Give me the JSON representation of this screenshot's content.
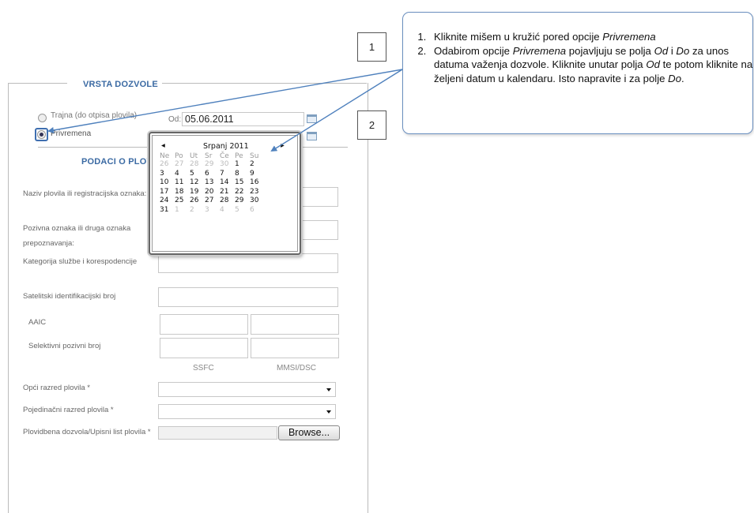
{
  "form": {
    "permit_section_title": "VRSTA DOZVOLE",
    "permit_options": [
      {
        "label": "Trajna (do otpisa plovila)",
        "selected": false
      },
      {
        "label": "Privremena",
        "selected": true
      }
    ],
    "from_label": "Od:",
    "from_value": "05.06.2011",
    "vessel_section_title": "PODACI O PLOV",
    "fields": [
      {
        "label": "Naziv plovila ili registracijska oznaka: *",
        "value": ""
      },
      {
        "label": "Pozivna oznaka ili druga oznaka prepoznavanja:",
        "value": ""
      },
      {
        "label": "Kategorija službe i korespodencije",
        "value": ""
      },
      {
        "label": "Satelitski identifikacijski broj",
        "value": ""
      },
      {
        "label": "AAIC",
        "value": ""
      },
      {
        "label": "Selektivni pozivni broj",
        "value": ""
      }
    ],
    "column_labels": [
      "SSFC",
      "MMSI/DSC"
    ],
    "selects": [
      {
        "label": "Opći razred plovila *",
        "value": ""
      },
      {
        "label": "Pojedinačni razred plovila *",
        "value": ""
      }
    ],
    "upload": {
      "label": "Plovidbena dozvola/Upisni list plovila *",
      "button": "Browse..."
    }
  },
  "datepicker": {
    "prev": "◂",
    "next": "▸",
    "month": "Srpanj 2011",
    "weekdays": [
      "Ne",
      "Po",
      "Ut",
      "Sr",
      "Če",
      "Pe",
      "Su"
    ],
    "weeks": [
      [
        {
          "d": "26",
          "m": true
        },
        {
          "d": "27",
          "m": true
        },
        {
          "d": "28",
          "m": true
        },
        {
          "d": "29",
          "m": true
        },
        {
          "d": "30",
          "m": true
        },
        {
          "d": "1",
          "m": false
        },
        {
          "d": "2",
          "m": false
        }
      ],
      [
        {
          "d": "3",
          "m": false
        },
        {
          "d": "4",
          "m": false
        },
        {
          "d": "5",
          "m": false
        },
        {
          "d": "6",
          "m": false
        },
        {
          "d": "7",
          "m": false
        },
        {
          "d": "8",
          "m": false
        },
        {
          "d": "9",
          "m": false
        }
      ],
      [
        {
          "d": "10",
          "m": false
        },
        {
          "d": "11",
          "m": false
        },
        {
          "d": "12",
          "m": false
        },
        {
          "d": "13",
          "m": false
        },
        {
          "d": "14",
          "m": false
        },
        {
          "d": "15",
          "m": false
        },
        {
          "d": "16",
          "m": false
        }
      ],
      [
        {
          "d": "17",
          "m": false
        },
        {
          "d": "18",
          "m": false
        },
        {
          "d": "19",
          "m": false
        },
        {
          "d": "20",
          "m": false
        },
        {
          "d": "21",
          "m": false
        },
        {
          "d": "22",
          "m": false
        },
        {
          "d": "23",
          "m": false
        }
      ],
      [
        {
          "d": "24",
          "m": false
        },
        {
          "d": "25",
          "m": false
        },
        {
          "d": "26",
          "m": false
        },
        {
          "d": "27",
          "m": false
        },
        {
          "d": "28",
          "m": false
        },
        {
          "d": "29",
          "m": false
        },
        {
          "d": "30",
          "m": false
        }
      ],
      [
        {
          "d": "31",
          "m": false
        },
        {
          "d": "1",
          "m": true
        },
        {
          "d": "2",
          "m": true
        },
        {
          "d": "3",
          "m": true
        },
        {
          "d": "4",
          "m": true
        },
        {
          "d": "5",
          "m": true
        },
        {
          "d": "6",
          "m": true
        }
      ]
    ]
  },
  "callouts": {
    "marker_1": "1",
    "marker_2": "2",
    "instructions": [
      [
        "Kliknite mišem u kružić pored opcije ",
        {
          "em": "Privremena"
        }
      ],
      [
        "Odabirom opcije ",
        {
          "em": "Privremena"
        },
        "  pojavljuju se polja ",
        {
          "em": "Od"
        },
        " i ",
        {
          "em": "Do"
        },
        " za unos datuma važenja dozvole. Kliknite unutar polja ",
        {
          "em": "Od"
        },
        " te potom kliknite na željeni datum u kalendaru. Isto napravite i za polje ",
        {
          "em": "Do"
        },
        "."
      ]
    ]
  },
  "colors": {
    "accent": "#3b6aa3",
    "callout_border": "#6a8fbf",
    "arrow": "#4f81bd"
  }
}
